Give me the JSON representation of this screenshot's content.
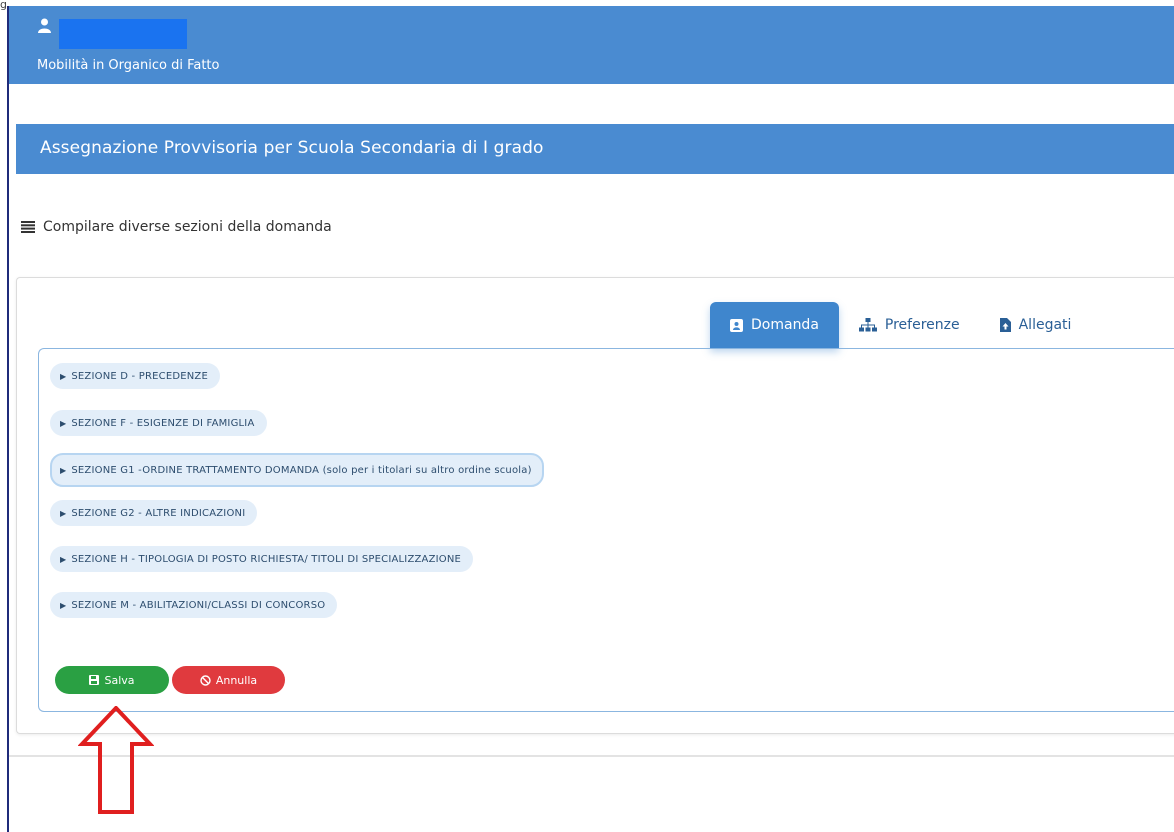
{
  "corner_mark": "g",
  "header": {
    "user_icon": "user-icon",
    "app_title": "Mobilità in Organico di Fatto"
  },
  "page": {
    "title": "Assegnazione Provvisoria per Scuola Secondaria di I grado"
  },
  "hint": {
    "icon": "list-icon",
    "text": "Compilare diverse sezioni della domanda"
  },
  "tabs": [
    {
      "label": "Domanda",
      "icon": "contact-card-icon",
      "active": true
    },
    {
      "label": "Preferenze",
      "icon": "sitemap-icon",
      "active": false
    },
    {
      "label": "Allegati",
      "icon": "file-upload-icon",
      "active": false
    }
  ],
  "sections": [
    {
      "label": "SEZIONE D - PRECEDENZE"
    },
    {
      "label": "SEZIONE F - ESIGENZE DI FAMIGLIA"
    },
    {
      "label": "SEZIONE G1 -ORDINE TRATTAMENTO DOMANDA (solo per i titolari su altro ordine scuola)",
      "selected": true
    },
    {
      "label": "SEZIONE G2 - ALTRE INDICAZIONI"
    },
    {
      "label": "SEZIONE H - TIPOLOGIA DI POSTO RICHIESTA/ TITOLI DI SPECIALIZZAZIONE"
    },
    {
      "label": "SEZIONE M - ABILITAZIONI/CLASSI DI CONCORSO"
    }
  ],
  "actions": {
    "save_label": "Salva",
    "save_icon": "save-icon",
    "cancel_label": "Annulla",
    "cancel_icon": "ban-icon"
  },
  "colors": {
    "header_blue": "#4a8bd1",
    "tab_active": "#3f86cd",
    "save_green": "#2aa043",
    "cancel_red": "#e03a3e",
    "section_bg": "#e3eef9",
    "arrow_red": "#e01f1f"
  }
}
